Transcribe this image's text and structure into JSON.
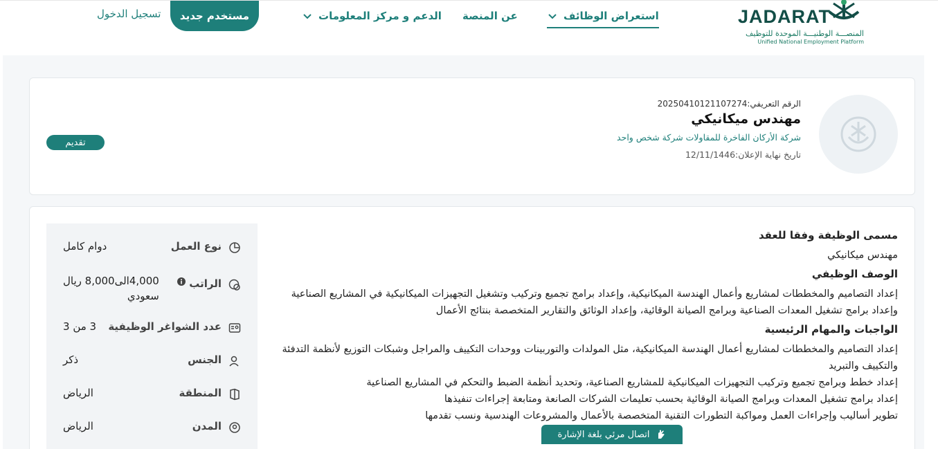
{
  "header": {
    "logo_brand": "JADARAT",
    "logo_ar": "المنصـــة الوطنيـــة الموحدة للتوظيف",
    "logo_en": "Unified National Employment Platform",
    "nav": {
      "browse_jobs": "استعراض الوظائف",
      "about": "عن المنصة",
      "support": "الدعم و مركز المعلومات"
    },
    "new_user": "مستخدم جديد",
    "login": "تسجيل الدخول"
  },
  "job": {
    "reference": "الرقم التعريفي:20250410121107274",
    "title": "مهندس ميكانيكي",
    "company": "شركة الأركان الفاخرة للمقاولات شركة شخص واحد",
    "deadline": "تاريخ نهاية الإعلان:12/11/1446",
    "apply": "تقديم"
  },
  "details": {
    "work_type_label": "نوع العمل",
    "work_type_value": "دوام كامل",
    "salary_label": "الراتب",
    "salary_value_1": "4,000الى8,000 ريال",
    "salary_value_2": "سعودي",
    "vacancies_label": "عدد الشواغر الوظيفية",
    "vacancies_value": "3 من 3",
    "gender_label": "الجنس",
    "gender_value": "ذكر",
    "region_label": "المنطقة",
    "region_value": "الرياض",
    "cities_label": "المدن",
    "cities_value": "الرياض"
  },
  "description": {
    "contract_title_heading": "مسمى الوظيفة وفقا للعقد",
    "contract_title": "مهندس ميكانيكي",
    "job_desc_heading": "الوصف الوظيفي",
    "job_desc": "إعداد التصاميم والمخططات لمشاريع وأعمال الهندسة الميكانيكية، وإعداد برامج تجميع وتركيب وتشغيل التجهيزات الميكانيكية في المشاريع الصناعية وإعداد برامج تشغيل المعدات الصناعية وبرامج الصيانة الوقائية، وإعداد الوثائق والتقارير المتخصصة بنتائج الأعمال",
    "duties_heading": "الواجبات والمهام الرئيسية",
    "duty_1": "إعداد التصاميم والمخططات لمشاريع أعمال الهندسة الميكانيكية، مثل المولدات والتوربينات ووحدات التكييف والمراجل وشبكات التوزيع لأنظمة التدفئة والتكييف والتبريد",
    "duty_2": "إعداد خطط وبرامج تجميع وتركيب التجهيزات الميكانيكية للمشاريع الصناعية، وتحديد أنظمة الضبط والتحكم في المشاريع الصناعية",
    "duty_3": "إعداد برامج تشغيل المعدات وبرامج الصيانة الوقائية بحسب تعليمات الشركات الصانعة ومتابعة إجراءات تنفيذها",
    "duty_4": "تطوير أساليب وإجراءات العمل ومواكبة التطورات التقنية المتخصصة بالأعمال والمشروعات الهندسية ونسب تقدمها"
  },
  "sign_language": "اتصال مرئي بلغة الإشارة",
  "colors": {
    "primary": "#1e7f7a",
    "background": "#f5f7f9"
  }
}
